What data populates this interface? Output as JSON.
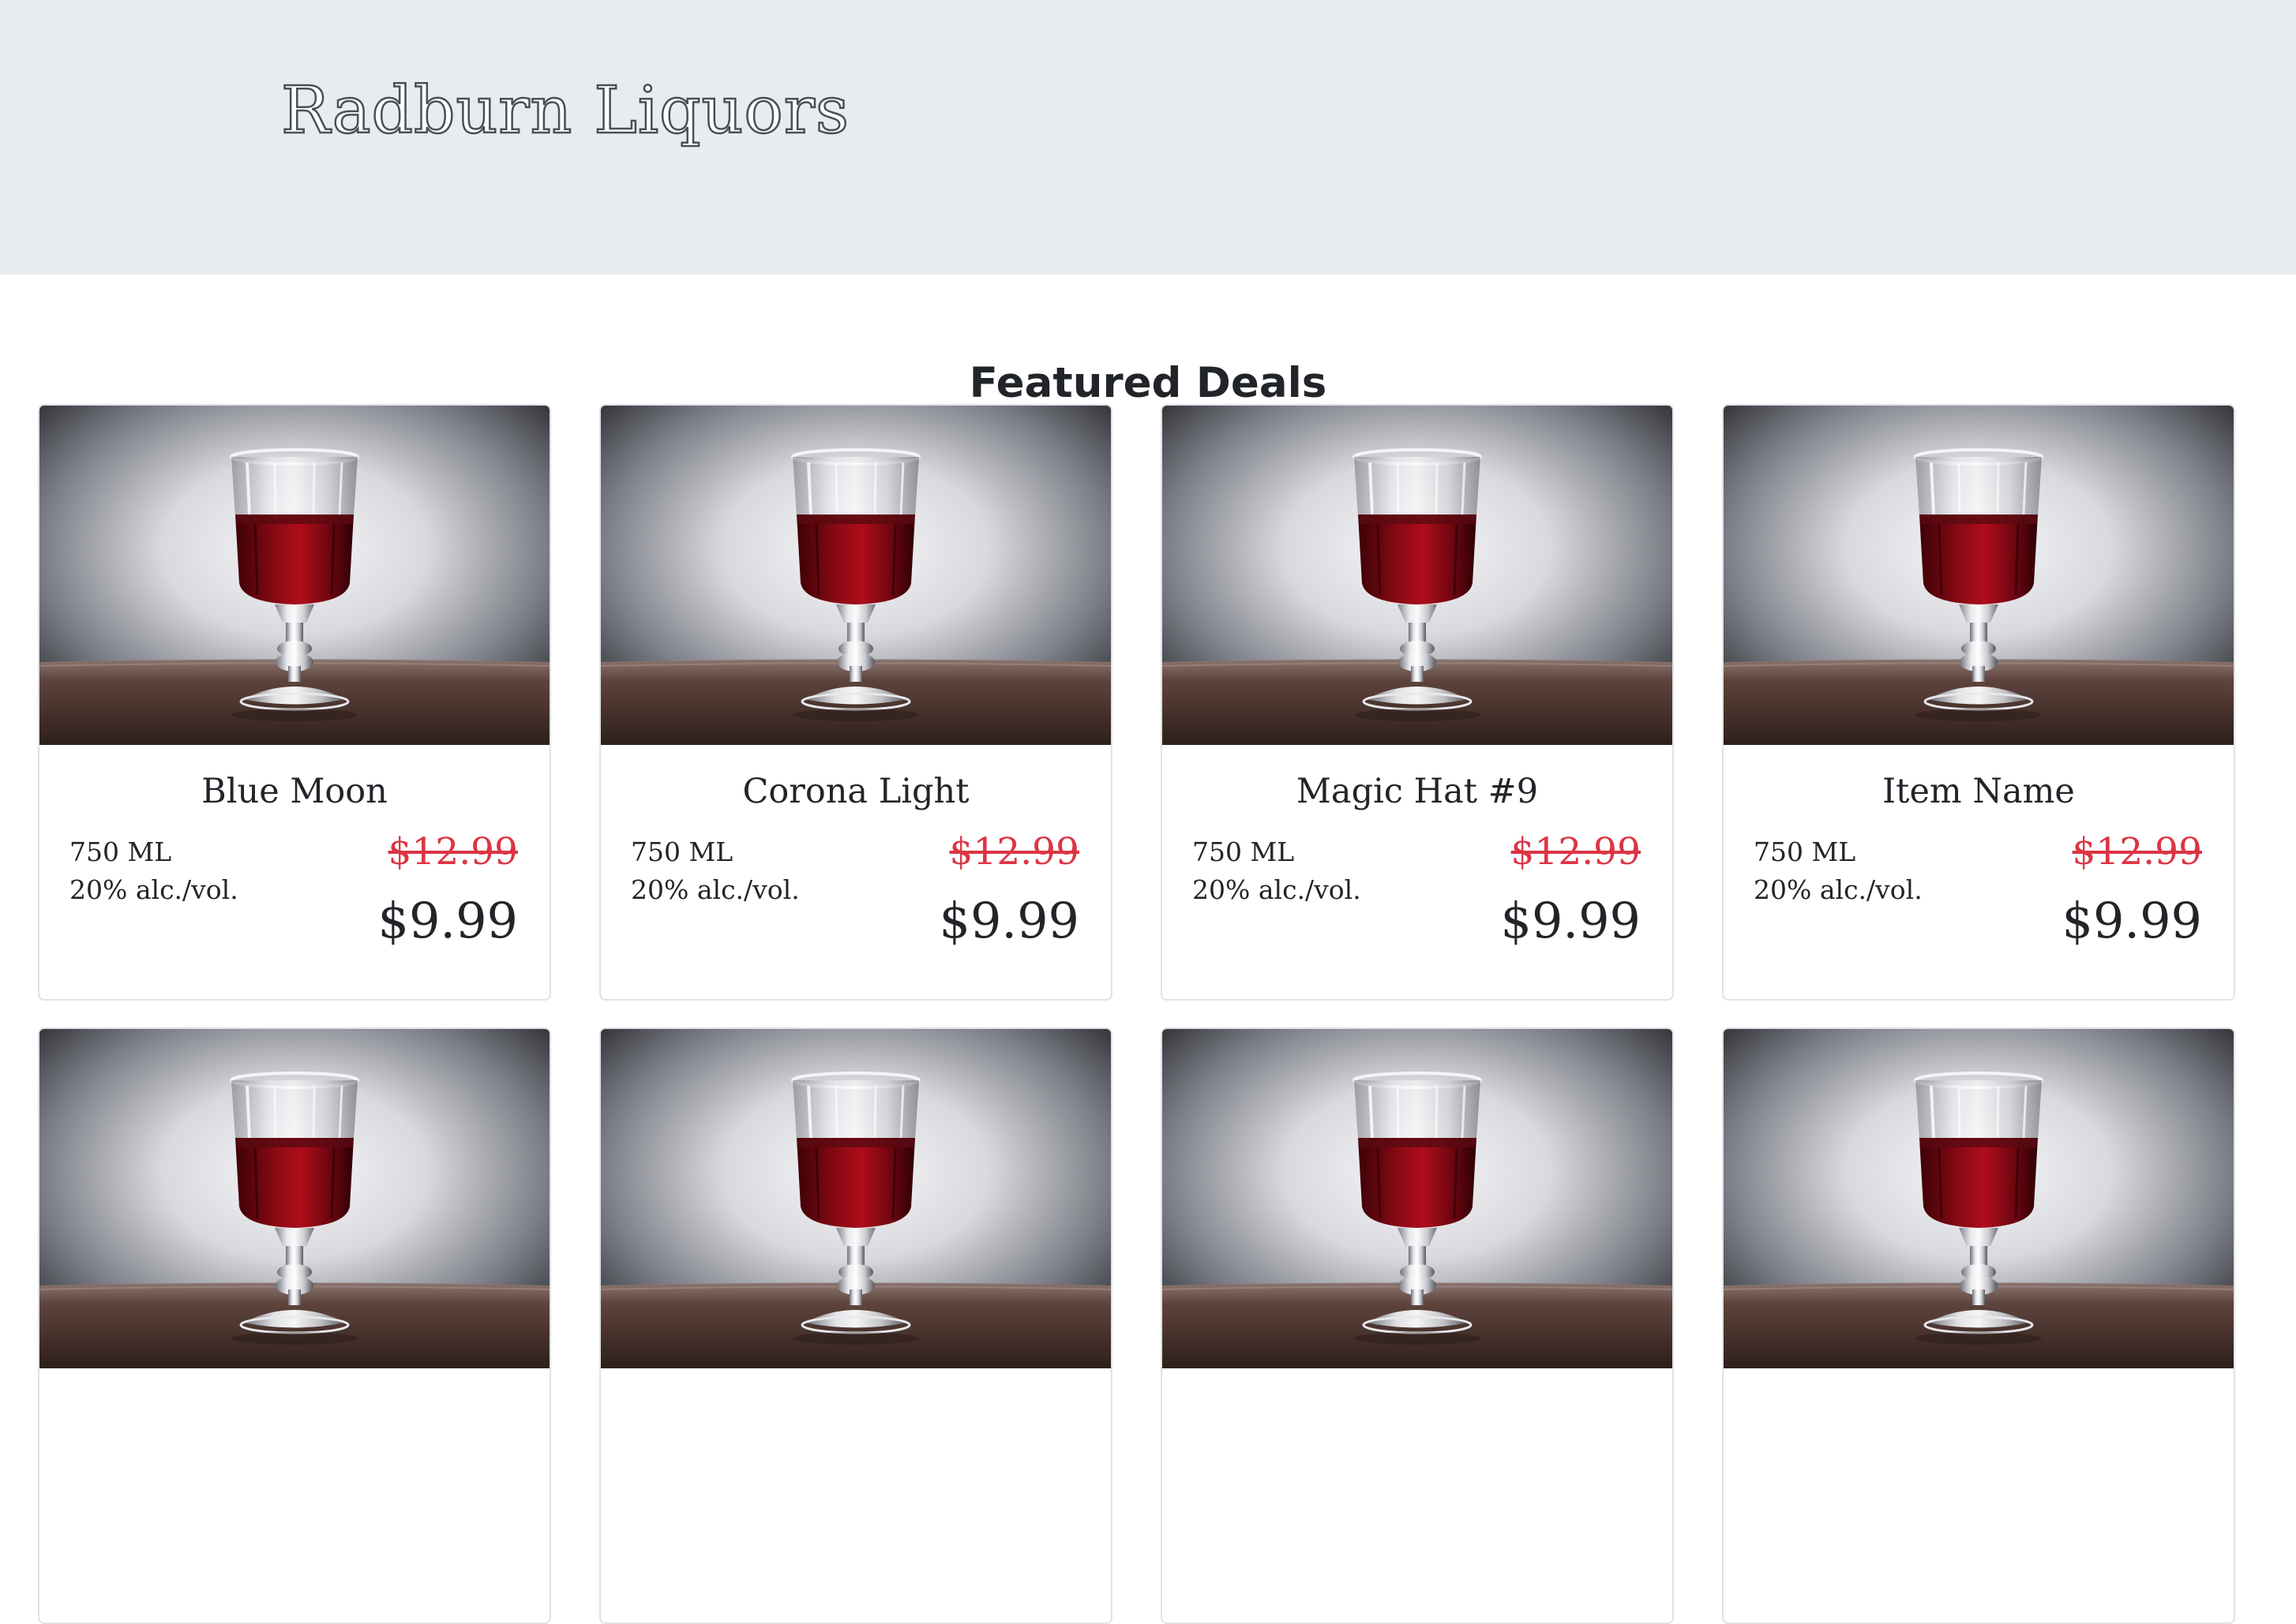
{
  "header": {
    "brand": "Radburn Liquors"
  },
  "section": {
    "title": "Featured Deals"
  },
  "products": [
    {
      "name": "Blue Moon",
      "volume": "750 ML",
      "abv": "20% alc./vol.",
      "old_price": "$12.99",
      "price": "$9.99"
    },
    {
      "name": "Corona Light",
      "volume": "750 ML",
      "abv": "20% alc./vol.",
      "old_price": "$12.99",
      "price": "$9.99"
    },
    {
      "name": "Magic Hat #9",
      "volume": "750 ML",
      "abv": "20% alc./vol.",
      "old_price": "$12.99",
      "price": "$9.99"
    },
    {
      "name": "Item Name",
      "volume": "750 ML",
      "abv": "20% alc./vol.",
      "old_price": "$12.99",
      "price": "$9.99"
    },
    {},
    {},
    {},
    {}
  ],
  "image": {
    "icon": "wine-glass-photo"
  },
  "colors": {
    "header_bg": "#e9ecef",
    "old_price": "#dc3545",
    "wine": "#8b0a14",
    "table": "#5a3d36"
  }
}
